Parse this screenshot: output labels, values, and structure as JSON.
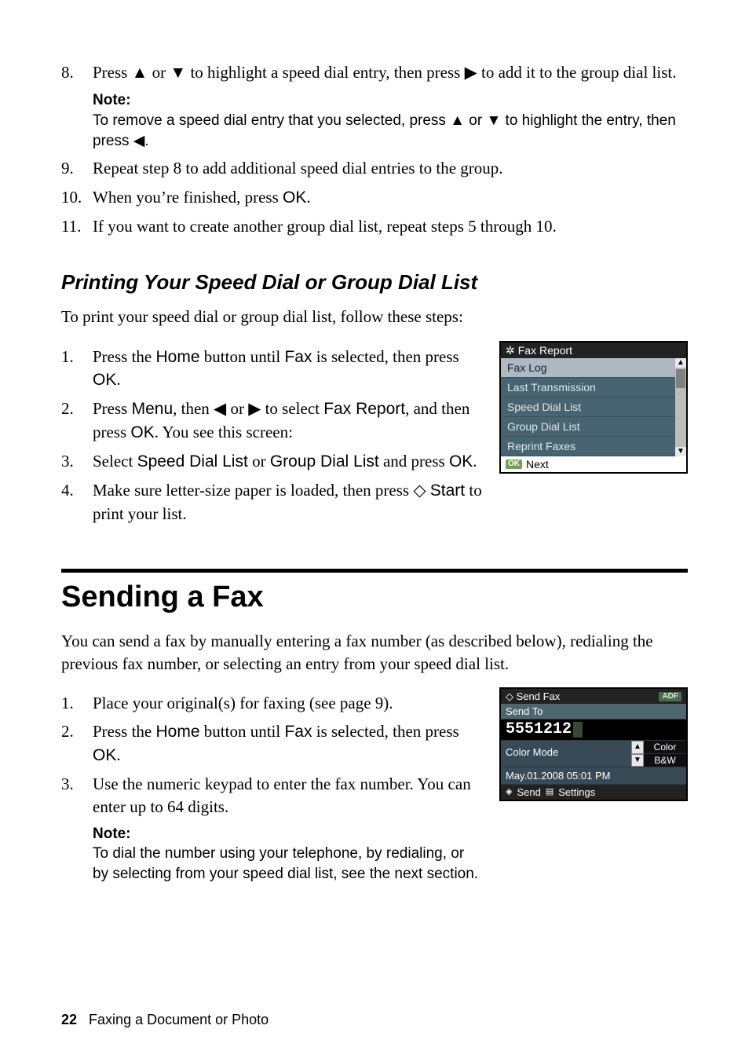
{
  "icons": {
    "up": "▲",
    "down": "▼",
    "left": "◀",
    "right": "▶",
    "diamond": "◇",
    "gear": "✲",
    "menu": "▤",
    "start": "◈"
  },
  "top_steps": [
    {
      "num": "8.",
      "segments": [
        {
          "kind": "t",
          "text": "Press "
        },
        {
          "kind": "icon",
          "ref": "up",
          "name": "up-arrow-icon"
        },
        {
          "kind": "t",
          "text": " or "
        },
        {
          "kind": "icon",
          "ref": "down",
          "name": "down-arrow-icon"
        },
        {
          "kind": "t",
          "text": " to highlight a speed dial entry, then press "
        },
        {
          "kind": "icon",
          "ref": "right",
          "name": "right-arrow-icon"
        },
        {
          "kind": "t",
          "text": " to add it to the group dial list."
        }
      ],
      "note": {
        "label": "Note:",
        "segments": [
          {
            "kind": "t",
            "text": "To remove a speed dial entry that you selected, press  "
          },
          {
            "kind": "icon",
            "ref": "up",
            "name": "up-arrow-icon"
          },
          {
            "kind": "t",
            "text": " or "
          },
          {
            "kind": "icon",
            "ref": "down",
            "name": "down-arrow-icon"
          },
          {
            "kind": "t",
            "text": " to highlight the entry, then press "
          },
          {
            "kind": "icon",
            "ref": "left",
            "name": "left-arrow-icon"
          },
          {
            "kind": "t",
            "text": "."
          }
        ]
      }
    },
    {
      "num": "9.",
      "segments": [
        {
          "kind": "t",
          "text": "Repeat step 8 to add additional speed dial entries to the group."
        }
      ]
    },
    {
      "num": "10.",
      "segments": [
        {
          "kind": "t",
          "text": "When you’re finished, press "
        },
        {
          "kind": "ui",
          "text": "OK"
        },
        {
          "kind": "t",
          "text": "."
        }
      ]
    },
    {
      "num": "11.",
      "segments": [
        {
          "kind": "t",
          "text": "If you want to create another group dial list, repeat steps 5 through 10."
        }
      ]
    }
  ],
  "subhead": {
    "heading": "Printing Your Speed Dial or Group Dial List",
    "intro": "To print your speed dial or group dial list, follow these steps:",
    "steps": [
      {
        "num": "1.",
        "segments": [
          {
            "kind": "t",
            "text": "Press the "
          },
          {
            "kind": "ui",
            "text": "Home"
          },
          {
            "kind": "t",
            "text": " button until "
          },
          {
            "kind": "ui",
            "text": "Fax"
          },
          {
            "kind": "t",
            "text": " is selected, then press "
          },
          {
            "kind": "ui",
            "text": "OK"
          },
          {
            "kind": "t",
            "text": "."
          }
        ]
      },
      {
        "num": "2.",
        "segments": [
          {
            "kind": "t",
            "text": "Press "
          },
          {
            "kind": "ui",
            "text": "Menu"
          },
          {
            "kind": "t",
            "text": ", then "
          },
          {
            "kind": "icon",
            "ref": "left",
            "name": "left-arrow-icon"
          },
          {
            "kind": "t",
            "text": " or "
          },
          {
            "kind": "icon",
            "ref": "right",
            "name": "right-arrow-icon"
          },
          {
            "kind": "t",
            "text": " to select "
          },
          {
            "kind": "ui",
            "text": "Fax Report"
          },
          {
            "kind": "t",
            "text": ", and then press "
          },
          {
            "kind": "ui",
            "text": "OK"
          },
          {
            "kind": "t",
            "text": ". You see this screen:"
          }
        ]
      },
      {
        "num": "3.",
        "segments": [
          {
            "kind": "t",
            "text": "Select "
          },
          {
            "kind": "ui",
            "text": "Speed Dial List"
          },
          {
            "kind": "t",
            "text": " or "
          },
          {
            "kind": "ui",
            "text": "Group Dial List"
          },
          {
            "kind": "t",
            "text": " and press "
          },
          {
            "kind": "ui",
            "text": "OK"
          },
          {
            "kind": "t",
            "text": "."
          }
        ]
      },
      {
        "num": "4.",
        "segments": [
          {
            "kind": "t",
            "text": "Make sure letter-size paper is loaded, then press "
          },
          {
            "kind": "icon",
            "ref": "diamond",
            "name": "start-diamond-icon"
          },
          {
            "kind": "t",
            "text": " "
          },
          {
            "kind": "ui",
            "text": "Start"
          },
          {
            "kind": "t",
            "text": " to print your list."
          }
        ]
      }
    ]
  },
  "fax_report_screen": {
    "title": "Fax Report",
    "items": [
      "Fax Log",
      "Last Transmission",
      "Speed Dial List",
      "Group Dial List",
      "Reprint Faxes"
    ],
    "selected_index": 0,
    "ok_badge": "OK",
    "footer": "Next"
  },
  "section": {
    "heading": "Sending a Fax",
    "intro": "You can send a fax by manually entering a fax number (as described below), redialing the previous fax number, or selecting an entry from your speed dial list.",
    "steps": [
      {
        "num": "1.",
        "segments": [
          {
            "kind": "t",
            "text": "Place your original(s) for faxing (see page 9)."
          }
        ]
      },
      {
        "num": "2.",
        "segments": [
          {
            "kind": "t",
            "text": "Press the "
          },
          {
            "kind": "ui",
            "text": "Home"
          },
          {
            "kind": "t",
            "text": " button until "
          },
          {
            "kind": "ui",
            "text": "Fax"
          },
          {
            "kind": "t",
            "text": " is selected, then press "
          },
          {
            "kind": "ui",
            "text": "OK"
          },
          {
            "kind": "t",
            "text": "."
          }
        ]
      },
      {
        "num": "3.",
        "segments": [
          {
            "kind": "t",
            "text": "Use the numeric keypad to enter the fax number. You can enter up to 64 digits."
          }
        ],
        "note": {
          "label": "Note:",
          "segments": [
            {
              "kind": "t",
              "text": "To dial the number using your telephone, by redialing, or by selecting from your speed dial list, see the next section."
            }
          ]
        }
      }
    ]
  },
  "send_fax_screen": {
    "title": "Send Fax",
    "adf": "ADF",
    "send_to": "Send To",
    "number": "5551212",
    "color_mode_label": "Color Mode",
    "options": {
      "color": "Color",
      "bw": "B&W"
    },
    "datetime": "May.01.2008  05:01 PM",
    "footer_send": "Send",
    "footer_settings": "Settings"
  },
  "footer": {
    "page": "22",
    "text": "Faxing a Document or Photo"
  }
}
